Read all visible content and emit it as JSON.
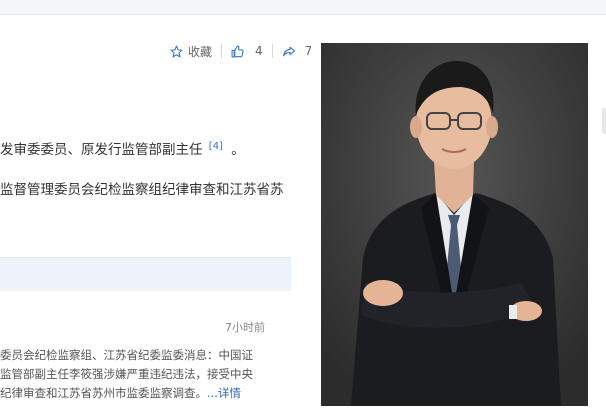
{
  "actions": {
    "favorite_label": "收藏",
    "like_count": "4",
    "share_count": "7"
  },
  "body": {
    "line1": "发审委委员、原发行监管部副主任",
    "line1_ref": "[4]",
    "line1_end": "。",
    "line2": "监督管理委员会纪检监察组纪律审查和江苏省苏"
  },
  "news": {
    "time": "7小时前",
    "lines": [
      "委员会纪检监察组、江苏省纪委监委消息：中国证",
      "监管部副主任李筱强涉嫌严重违纪违法，接受中央",
      "纪律审查和江苏省苏州市监委监察调查。"
    ],
    "more_label": "...详情"
  },
  "colors": {
    "accent": "#3b73c9",
    "photo_bg": "#3b3b3b",
    "panel_bg": "#eef2f9"
  },
  "icons": [
    "star-icon",
    "thumbs-up-icon",
    "share-icon"
  ]
}
